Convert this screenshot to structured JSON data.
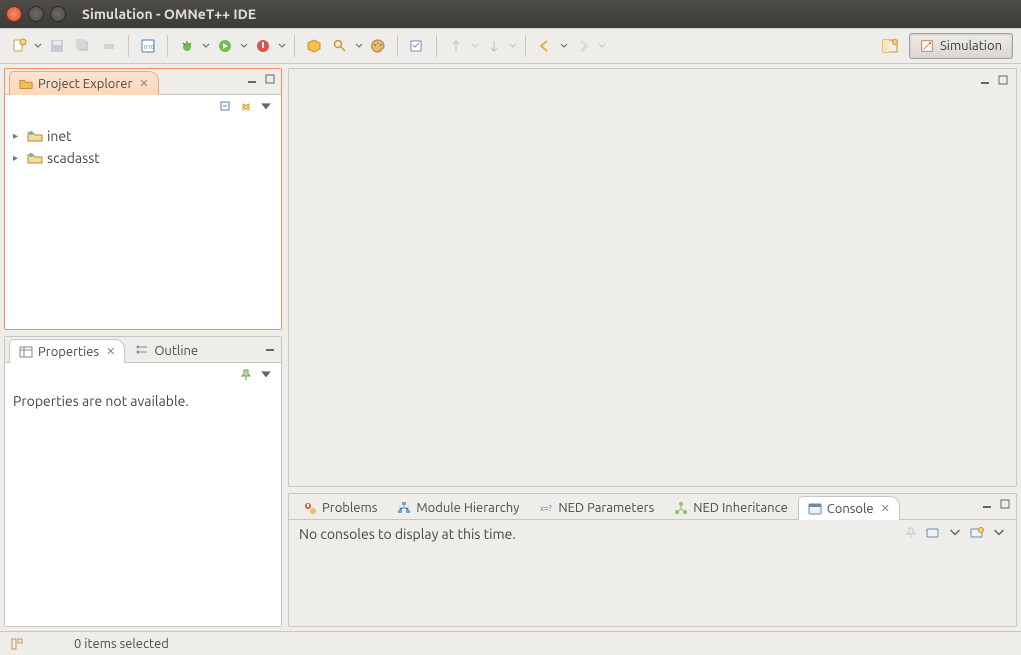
{
  "window": {
    "title": "Simulation - OMNeT++ IDE"
  },
  "perspective": {
    "label": "Simulation"
  },
  "projectExplorer": {
    "title": "Project Explorer",
    "items": [
      {
        "label": "inet"
      },
      {
        "label": "scadasst"
      }
    ]
  },
  "properties": {
    "title": "Properties",
    "message": "Properties are not available."
  },
  "outline": {
    "title": "Outline"
  },
  "bottomTabs": {
    "problems": "Problems",
    "moduleHierarchy": "Module Hierarchy",
    "nedParameters": "NED Parameters",
    "nedInheritance": "NED Inheritance",
    "console": "Console"
  },
  "console": {
    "message": "No consoles to display at this time."
  },
  "statusbar": {
    "message": "0 items selected"
  }
}
